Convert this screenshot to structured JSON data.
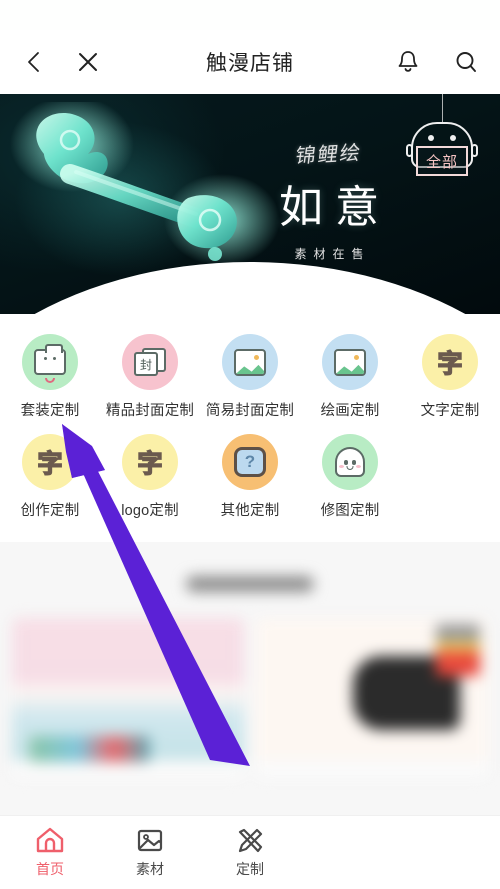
{
  "header": {
    "title": "触漫店铺",
    "back_icon": "chevron-left-icon",
    "close_icon": "close-icon",
    "bell_icon": "bell-icon",
    "search_icon": "search-icon"
  },
  "banner": {
    "script_text": "锦鲤绘",
    "main_text": "如意",
    "sub_text": "素材在售",
    "badge_label": "全部",
    "badge_icon": "robot-sign-icon",
    "bg_color": "#04171a",
    "accent_color": "#6fe6cf",
    "ribbon_color": "#e0463f",
    "carousel_dot": "active"
  },
  "categories": {
    "row1": [
      {
        "label": "套装定制",
        "icon": "folder-smile-icon",
        "bubble_color": "#b8ecc4"
      },
      {
        "label": "精品封面定制",
        "icon": "cover-cards-icon",
        "bubble_color": "#f7c3ce",
        "glyph": "封"
      },
      {
        "label": "简易封面定制",
        "icon": "image-icon",
        "bubble_color": "#c3dff2"
      },
      {
        "label": "绘画定制",
        "icon": "image-icon",
        "bubble_color": "#c3dff2"
      },
      {
        "label": "文字定制",
        "icon": "text-zi-icon",
        "bubble_color": "#fbf0a8",
        "glyph": "字"
      }
    ],
    "row2": [
      {
        "label": "创作定制",
        "icon": "text-zi-icon",
        "bubble_color": "#fbf0a8",
        "glyph": "字"
      },
      {
        "label": "logo定制",
        "icon": "text-zi-icon",
        "bubble_color": "#fbf0a8",
        "glyph": "字"
      },
      {
        "label": "其他定制",
        "icon": "question-icon",
        "bubble_color": "#f7bf73",
        "glyph": "?"
      },
      {
        "label": "修图定制",
        "icon": "ghost-icon",
        "bubble_color": "#b8ecc4"
      }
    ]
  },
  "tabbar": {
    "items": [
      {
        "label": "首页",
        "icon": "home-icon",
        "active": true
      },
      {
        "label": "素材",
        "icon": "image-icon",
        "active": false
      },
      {
        "label": "定制",
        "icon": "pencil-ruler-icon",
        "active": false
      }
    ],
    "active_color": "#ef5f6b",
    "inactive_color": "#4a4a4a"
  },
  "annotation": {
    "arrow_color": "#5b21d6",
    "arrow_from": "250,765",
    "arrow_to": "64,424",
    "points_at": "套装定制"
  }
}
